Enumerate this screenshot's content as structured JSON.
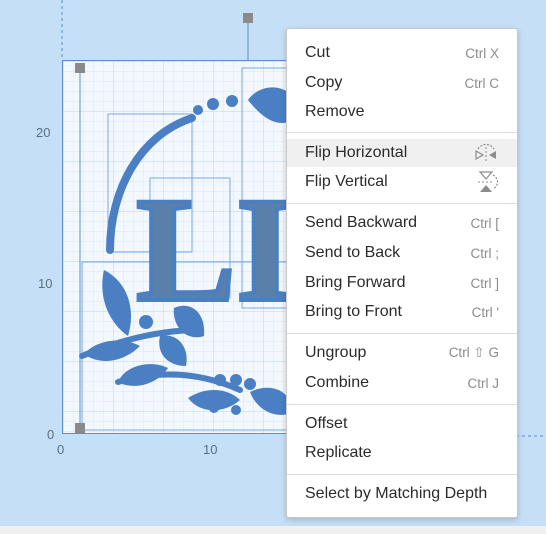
{
  "axis": {
    "y_ticks": [
      "20",
      "10",
      "0"
    ],
    "x_ticks": [
      "0",
      "10"
    ]
  },
  "artwork": {
    "letters": "LIN"
  },
  "menu": {
    "cut": {
      "label": "Cut",
      "shortcut": "Ctrl X"
    },
    "copy": {
      "label": "Copy",
      "shortcut": "Ctrl C"
    },
    "remove": {
      "label": "Remove"
    },
    "flip_horizontal": {
      "label": "Flip Horizontal",
      "icon": "flip-horizontal-icon"
    },
    "flip_vertical": {
      "label": "Flip Vertical",
      "icon": "flip-vertical-icon"
    },
    "send_backward": {
      "label": "Send Backward",
      "shortcut": "Ctrl ["
    },
    "send_to_back": {
      "label": "Send to Back",
      "shortcut": "Ctrl ;"
    },
    "bring_forward": {
      "label": "Bring Forward",
      "shortcut": "Ctrl ]"
    },
    "bring_to_front": {
      "label": "Bring to Front",
      "shortcut": "Ctrl '"
    },
    "ungroup": {
      "label": "Ungroup",
      "shortcut": "Ctrl ⇧ G"
    },
    "combine": {
      "label": "Combine",
      "shortcut": "Ctrl J"
    },
    "offset": {
      "label": "Offset"
    },
    "replicate": {
      "label": "Replicate"
    },
    "select_by_matching_depth": {
      "label": "Select by Matching Depth"
    }
  },
  "colors": {
    "canvas_bg": "#c5dff6",
    "artwork_blue": "#4a7fc4",
    "selection_blue": "#5b8fc9",
    "menu_text": "#2b2b2b",
    "shortcut_text": "#8c8c8c"
  }
}
